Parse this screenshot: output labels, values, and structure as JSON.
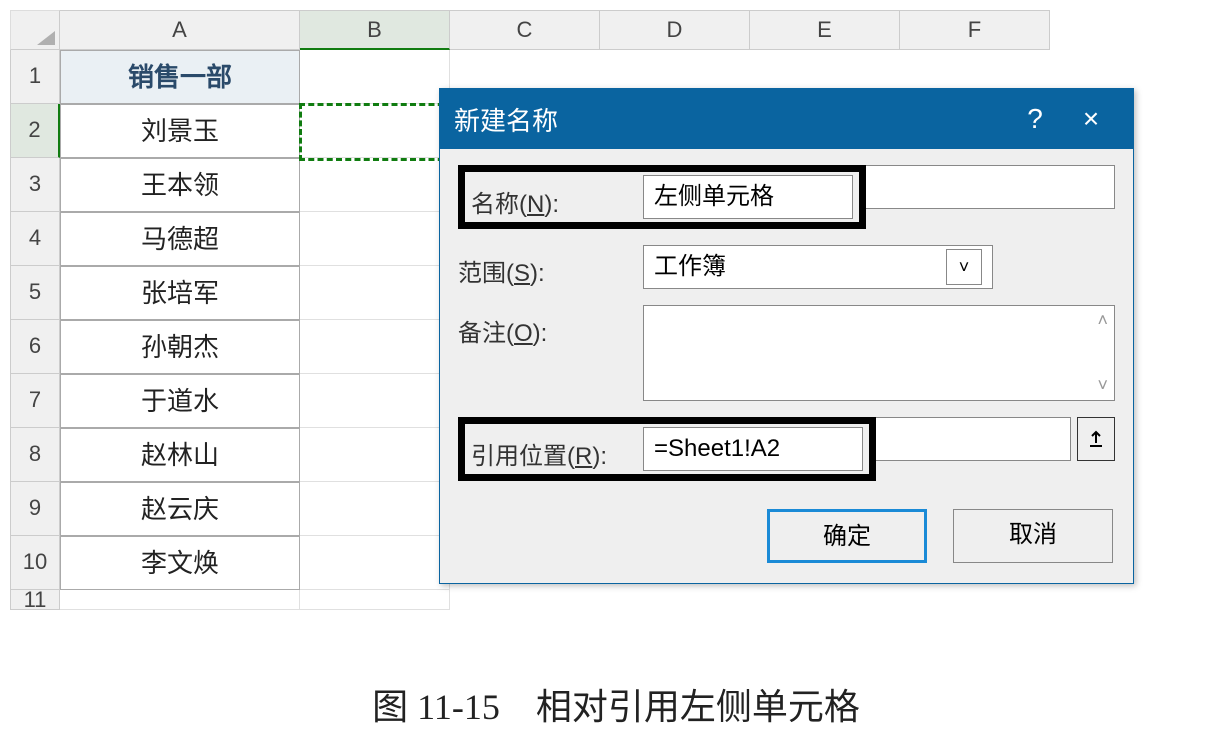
{
  "columns": [
    "A",
    "B",
    "C",
    "D",
    "E",
    "F"
  ],
  "rows": [
    "1",
    "2",
    "3",
    "4",
    "5",
    "6",
    "7",
    "8",
    "9",
    "10",
    "11"
  ],
  "cells": {
    "A": [
      "销售一部",
      "刘景玉",
      "王本领",
      "马德超",
      "张培军",
      "孙朝杰",
      "于道水",
      "赵林山",
      "赵云庆",
      "李文焕",
      ""
    ]
  },
  "selected_col": "B",
  "selected_row": "2",
  "dialog": {
    "title": "新建名称",
    "help": "?",
    "close": "×",
    "name_label": "名称(",
    "name_hot": "N",
    "name_label_suffix": "):",
    "name_value": "左侧单元格",
    "scope_label": "范围(",
    "scope_hot": "S",
    "scope_label_suffix": "):",
    "scope_value": "工作簿",
    "comment_label": "备注(",
    "comment_hot": "O",
    "comment_label_suffix": "):",
    "refers_label": "引用位置(",
    "refers_hot": "R",
    "refers_label_suffix": "):",
    "refers_value": "=Sheet1!A2",
    "ok": "确定",
    "cancel": "取消"
  },
  "caption": "图 11-15　相对引用左侧单元格"
}
